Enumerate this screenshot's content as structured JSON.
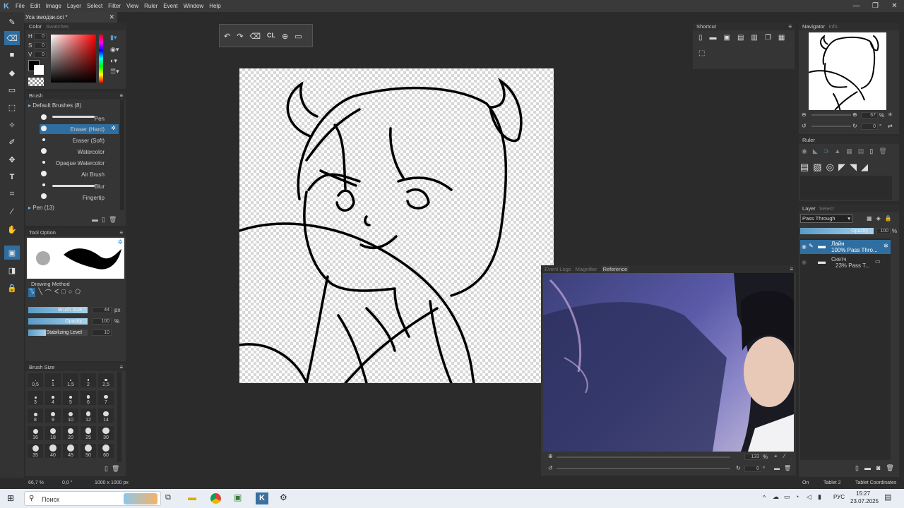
{
  "app": {
    "menu": [
      "File",
      "Edit",
      "Image",
      "Layer",
      "Select",
      "Filter",
      "View",
      "Ruler",
      "Event",
      "Window",
      "Help"
    ],
    "doc_tab": "Уса эмодзи.oci *",
    "win_controls": [
      "—",
      "❐",
      "✕"
    ]
  },
  "color_panel": {
    "tabs": [
      "Color",
      "Swatches"
    ],
    "labels": [
      "H",
      "S",
      "V"
    ],
    "values": [
      "0",
      "0",
      "0"
    ]
  },
  "brush_panel": {
    "title": "Brush",
    "group": "Default Brushes (8)",
    "items": [
      "Pen",
      "Eraser (Hard)",
      "Eraser (Soft)",
      "Watercolor",
      "Opaque Watercolor",
      "Air Brush",
      "Blur",
      "Fingertip"
    ],
    "group2": "Pen (13)"
  },
  "tool_option": {
    "title": "Tool Option",
    "drawing_method": "Drawing Method",
    "brush_size_label": "Brush Size",
    "brush_size_value": "44",
    "brush_size_unit": "px",
    "opacity_label": "Opacity",
    "opacity_value": "100",
    "opacity_unit": "%",
    "stabilizing_label": "Stabilizing Level",
    "stabilizing_value": "10"
  },
  "brush_size_panel": {
    "title": "Brush Size",
    "sizes": [
      "0,5",
      "1",
      "1,5",
      "2",
      "2,5",
      "3",
      "4",
      "5",
      "6",
      "7",
      "8",
      "9",
      "10",
      "12",
      "14",
      "16",
      "18",
      "20",
      "25",
      "30",
      "35",
      "40",
      "45",
      "50",
      "60"
    ]
  },
  "shortcut_panel": {
    "title": "Shortcut"
  },
  "navigator": {
    "tabs": [
      "Navigator",
      "Info"
    ],
    "zoom": "67",
    "zoom_unit": "%",
    "angle": "0",
    "angle_unit": "°"
  },
  "ruler_panel": {
    "title": "Ruler"
  },
  "layer_panel": {
    "tabs": [
      "Layer",
      "Select"
    ],
    "blend": "Pass Through",
    "opacity_label": "Opacity",
    "opacity_value": "100",
    "opacity_unit": "%",
    "layers": [
      {
        "name": "Лайн",
        "info": "100% Pass Thro..."
      },
      {
        "name": "Скетч",
        "info": "23% Pass T..."
      }
    ]
  },
  "reference_panel": {
    "tabs": [
      "Event Logs",
      "Magnifier",
      "Reference"
    ],
    "zoom": "133",
    "zoom_unit": "%",
    "angle": "0",
    "angle_unit": "°"
  },
  "statusbar": {
    "zoom": "66,7 %",
    "angle": "0,0 °",
    "size": "1000 x 1000 px",
    "on": "On",
    "tablet": "Tablet 2",
    "coords": "Tablet Coordinates"
  },
  "taskbar": {
    "search": "Поиск",
    "lang": "РУС",
    "time": "15:27",
    "date": "23.07.2025"
  },
  "floating_toolbar": {
    "cl_label": "CL"
  },
  "colors": {
    "accent": "#2f6ea0",
    "panel": "#353535",
    "bg": "#2b2b2b"
  }
}
